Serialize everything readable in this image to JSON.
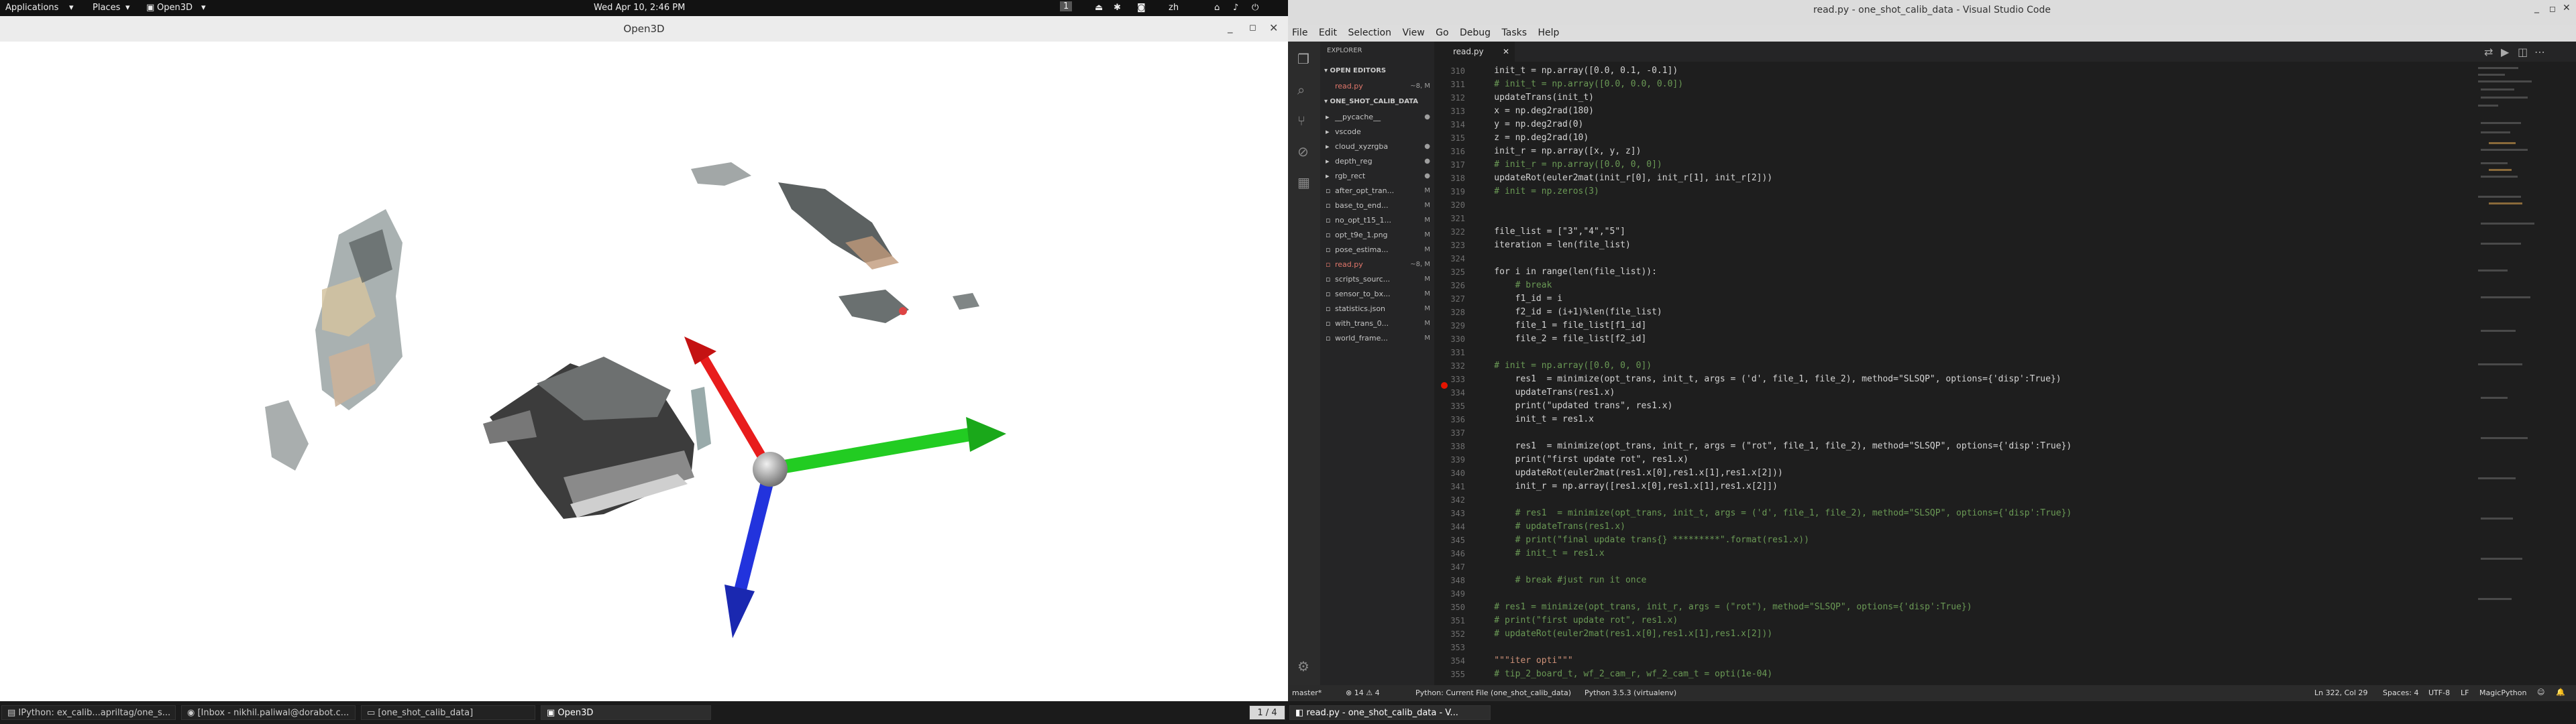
{
  "left_screen": {
    "topbar": {
      "applications": "Applications",
      "places": "Places",
      "active_app": "Open3D",
      "clock": "Wed Apr 10,  2:46 PM",
      "workspace": "1",
      "lang": "zh"
    },
    "window_title": "Open3D",
    "taskbar": {
      "items": [
        "IPython: ex_calib...apriltag/one_s...",
        "[Inbox - nikhil.paliwal@dorabot.c...",
        "[one_shot_calib_data]",
        "Open3D"
      ],
      "pager": "1 / 4"
    }
  },
  "right_screen": {
    "title": "read.py - one_shot_calib_data - Visual Studio Code",
    "menu": [
      "File",
      "Edit",
      "Selection",
      "View",
      "Go",
      "Debug",
      "Tasks",
      "Help"
    ],
    "sidebar": {
      "header": "EXPLORER",
      "open_editors": "OPEN EDITORS",
      "open_file": "read.py",
      "open_file_mark": "~8, M",
      "folder": "ONE_SHOT_CALIB_DATA",
      "items": [
        {
          "name": "__pycache__",
          "mark": "●"
        },
        {
          "name": "vscode",
          "mark": ""
        },
        {
          "name": "cloud_xyzrgba",
          "mark": "●"
        },
        {
          "name": "depth_reg",
          "mark": "●"
        },
        {
          "name": "rgb_rect",
          "mark": "●"
        },
        {
          "name": "after_opt_tran...",
          "mark": "M"
        },
        {
          "name": "base_to_end...",
          "mark": "M"
        },
        {
          "name": "no_opt_t15_1...",
          "mark": "M"
        },
        {
          "name": "opt_t9e_1.png",
          "mark": "M"
        },
        {
          "name": "pose_estima...",
          "mark": "M"
        },
        {
          "name": "read.py",
          "mark": "~8, M"
        },
        {
          "name": "scripts_sourc...",
          "mark": "M"
        },
        {
          "name": "sensor_to_bx...",
          "mark": "M"
        },
        {
          "name": "statistics.json",
          "mark": "M"
        },
        {
          "name": "with_trans_0...",
          "mark": "M"
        },
        {
          "name": "world_frame...",
          "mark": "M"
        }
      ]
    },
    "tab": "read.py",
    "code_lines": [
      {
        "n": "310",
        "t": "    init_t = np.array([0.0, 0.1, -0.1])",
        "c": "#d4d4d4"
      },
      {
        "n": "311",
        "t": "    # init_t = np.array([0.0, 0.0, 0.0])",
        "c": "#6a9955"
      },
      {
        "n": "312",
        "t": "    updateTrans(init_t)",
        "c": "#d4d4d4"
      },
      {
        "n": "313",
        "t": "    x = np.deg2rad(180)",
        "c": "#d4d4d4"
      },
      {
        "n": "314",
        "t": "    y = np.deg2rad(0)",
        "c": "#d4d4d4"
      },
      {
        "n": "315",
        "t": "    z = np.deg2rad(10)",
        "c": "#d4d4d4"
      },
      {
        "n": "316",
        "t": "    init_r = np.array([x, y, z])",
        "c": "#d4d4d4"
      },
      {
        "n": "317",
        "t": "    # init_r = np.array([0.0, 0, 0])",
        "c": "#6a9955"
      },
      {
        "n": "318",
        "t": "    updateRot(euler2mat(init_r[0], init_r[1], init_r[2]))",
        "c": "#d4d4d4"
      },
      {
        "n": "319",
        "t": "    # init = np.zeros(3)",
        "c": "#6a9955"
      },
      {
        "n": "320",
        "t": "",
        "c": "#d4d4d4"
      },
      {
        "n": "321",
        "t": "",
        "c": "#d4d4d4"
      },
      {
        "n": "322",
        "t": "    file_list = [\"3\",\"4\",\"5\"]",
        "c": "#d4d4d4"
      },
      {
        "n": "323",
        "t": "    iteration = len(file_list)",
        "c": "#d4d4d4"
      },
      {
        "n": "324",
        "t": "",
        "c": "#d4d4d4"
      },
      {
        "n": "325",
        "t": "    for i in range(len(file_list)):",
        "c": "#d4d4d4"
      },
      {
        "n": "326",
        "t": "        # break",
        "c": "#6a9955"
      },
      {
        "n": "327",
        "t": "        f1_id = i",
        "c": "#d4d4d4"
      },
      {
        "n": "328",
        "t": "        f2_id = (i+1)%len(file_list)",
        "c": "#d4d4d4"
      },
      {
        "n": "329",
        "t": "        file_1 = file_list[f1_id]",
        "c": "#d4d4d4"
      },
      {
        "n": "330",
        "t": "        file_2 = file_list[f2_id]",
        "c": "#d4d4d4"
      },
      {
        "n": "331",
        "t": "",
        "c": "#d4d4d4"
      },
      {
        "n": "332",
        "t": "    # init = np.array([0.0, 0, 0])",
        "c": "#6a9955"
      },
      {
        "n": "333",
        "t": "        res1  = minimize(opt_trans, init_t, args = ('d', file_1, file_2), method=\"SLSQP\", options={'disp':True})",
        "c": "#d4d4d4"
      },
      {
        "n": "334",
        "t": "        updateTrans(res1.x)",
        "c": "#d4d4d4"
      },
      {
        "n": "335",
        "t": "        print(\"updated trans\", res1.x)",
        "c": "#d4d4d4"
      },
      {
        "n": "336",
        "t": "        init_t = res1.x",
        "c": "#d4d4d4"
      },
      {
        "n": "337",
        "t": "",
        "c": "#d4d4d4"
      },
      {
        "n": "338",
        "t": "        res1  = minimize(opt_trans, init_r, args = (\"rot\", file_1, file_2), method=\"SLSQP\", options={'disp':True})",
        "c": "#d4d4d4"
      },
      {
        "n": "339",
        "t": "        print(\"first update rot\", res1.x)",
        "c": "#d4d4d4"
      },
      {
        "n": "340",
        "t": "        updateRot(euler2mat(res1.x[0],res1.x[1],res1.x[2]))",
        "c": "#d4d4d4"
      },
      {
        "n": "341",
        "t": "        init_r = np.array([res1.x[0],res1.x[1],res1.x[2]])",
        "c": "#d4d4d4"
      },
      {
        "n": "342",
        "t": "",
        "c": "#d4d4d4"
      },
      {
        "n": "343",
        "t": "        # res1  = minimize(opt_trans, init_t, args = ('d', file_1, file_2), method=\"SLSQP\", options={'disp':True})",
        "c": "#6a9955"
      },
      {
        "n": "344",
        "t": "        # updateTrans(res1.x)",
        "c": "#6a9955"
      },
      {
        "n": "345",
        "t": "        # print(\"final update trans{} *********\".format(res1.x))",
        "c": "#6a9955"
      },
      {
        "n": "346",
        "t": "        # init_t = res1.x",
        "c": "#6a9955"
      },
      {
        "n": "347",
        "t": "",
        "c": "#d4d4d4"
      },
      {
        "n": "348",
        "t": "        # break #just run it once",
        "c": "#6a9955"
      },
      {
        "n": "349",
        "t": "",
        "c": "#d4d4d4"
      },
      {
        "n": "350",
        "t": "    # res1 = minimize(opt_trans, init_r, args = (\"rot\"), method=\"SLSQP\", options={'disp':True})",
        "c": "#6a9955"
      },
      {
        "n": "351",
        "t": "    # print(\"first update rot\", res1.x)",
        "c": "#6a9955"
      },
      {
        "n": "352",
        "t": "    # updateRot(euler2mat(res1.x[0],res1.x[1],res1.x[2]))",
        "c": "#6a9955"
      },
      {
        "n": "353",
        "t": "",
        "c": "#d4d4d4"
      },
      {
        "n": "354",
        "t": "    \"\"\"iter opti\"\"\"",
        "c": "#ce9178"
      },
      {
        "n": "355",
        "t": "    # tip_2_board_t, wf_2_cam_r, wf_2_cam_t = opti(1e-04)",
        "c": "#6a9955"
      }
    ],
    "statusbar": {
      "branch": "master*",
      "problems": "⊗ 14 ⚠ 4",
      "python_cfg": "Python: Current File (one_shot_calib_data)",
      "interpreter": "Python 3.5.3 (virtualenv)",
      "position": "Ln 322, Col 29",
      "spaces": "Spaces: 4",
      "encoding": "UTF-8",
      "eol": "LF",
      "language": "MagicPython"
    },
    "taskbar": {
      "item": "read.py - one_shot_calib_data - V..."
    }
  },
  "colors": {
    "x_axis": "#e81c1c",
    "y_axis": "#22cc22",
    "z_axis": "#2233dd"
  }
}
